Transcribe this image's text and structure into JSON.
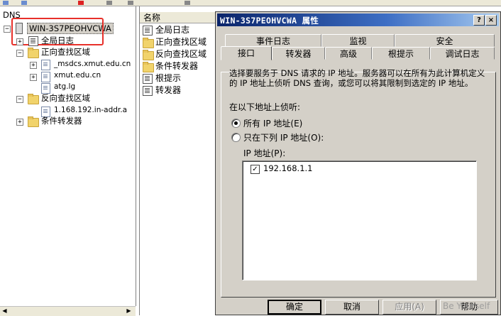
{
  "tree": {
    "root": "DNS",
    "server": "WIN-3S7PEOHVCWA",
    "items": [
      {
        "label": "全局日志"
      },
      {
        "label": "正向查找区域"
      },
      {
        "label": "_msdcs.xmut.edu.cn"
      },
      {
        "label": "xmut.edu.cn"
      },
      {
        "label": "atg.lg"
      },
      {
        "label": "反向查找区域"
      },
      {
        "label": "1.168.192.in-addr.a"
      },
      {
        "label": "条件转发器"
      }
    ]
  },
  "list": {
    "header": "名称",
    "items": [
      {
        "label": "全局日志"
      },
      {
        "label": "正向查找区域"
      },
      {
        "label": "反向查找区域"
      },
      {
        "label": "条件转发器"
      },
      {
        "label": "根提示"
      },
      {
        "label": "转发器"
      }
    ]
  },
  "dialog": {
    "title": "WIN-3S7PEOHVCWA 属性",
    "help_btn": "?",
    "close_btn": "×",
    "tabs_row1": [
      "事件日志",
      "监视",
      "安全"
    ],
    "tabs_row2": [
      "接口",
      "转发器",
      "高级",
      "根提示",
      "调试日志"
    ],
    "active_tab": "接口",
    "description": "选择要服务于 DNS 请求的 IP 地址。服务器可以在所有为此计算机定义的 IP 地址上侦听 DNS 查询，或您可以将其限制到选定的 IP 地址。",
    "listen_label": "在以下地址上侦听:",
    "radio_all": "所有 IP 地址(E)",
    "radio_only": "只在下列 IP 地址(O):",
    "ip_label": "IP 地址(P):",
    "ip_addresses": [
      "192.168.1.1"
    ],
    "buttons": {
      "ok": "确定",
      "cancel": "取消",
      "apply": "应用(A)",
      "help": "帮助"
    }
  },
  "watermark": "Be Yourself"
}
